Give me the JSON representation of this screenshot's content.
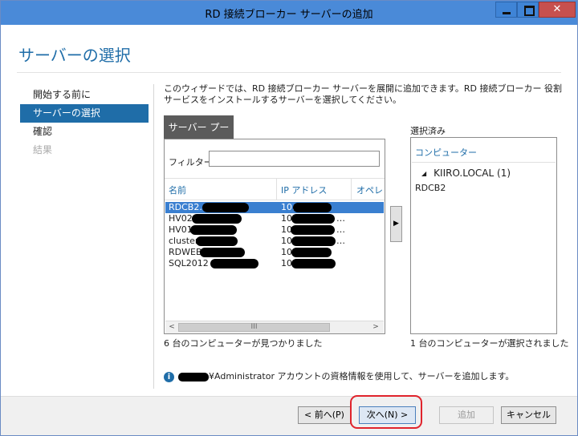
{
  "window": {
    "title": "RD 接続ブローカー サーバーの追加",
    "controls": {
      "minimize_icon": "minimize-icon",
      "maximize_icon": "maximize-icon",
      "close_label": "✕"
    }
  },
  "page": {
    "heading": "サーバーの選択"
  },
  "nav": {
    "items": [
      {
        "label": "開始する前に",
        "state": "normal"
      },
      {
        "label": "サーバーの選択",
        "state": "active"
      },
      {
        "label": "確認",
        "state": "normal"
      },
      {
        "label": "結果",
        "state": "disabled"
      }
    ]
  },
  "description": "このウィザードでは、RD 接続ブローカー サーバーを展開に追加できます。RD 接続ブローカー 役割サービスをインストールするサーバーを選択してください。",
  "server_pool": {
    "tab_label": "サーバー プール",
    "filter_label": "フィルター:",
    "filter_value": "",
    "columns": [
      "名前",
      "IP アドレス",
      "オペレー"
    ],
    "rows": [
      {
        "name": "RDCB2.",
        "ip": "10.",
        "ip_suffix": "",
        "selected": true
      },
      {
        "name": "HV02",
        "ip": "10",
        "ip_suffix": "…",
        "selected": false
      },
      {
        "name": "HV01",
        "ip": "10",
        "ip_suffix": "…",
        "selected": false
      },
      {
        "name": "cluster",
        "ip": "10",
        "ip_suffix": "…",
        "selected": false
      },
      {
        "name": "RDWEB",
        "ip": "10",
        "ip_suffix": "",
        "selected": false
      },
      {
        "name": "SQL2012",
        "ip": "10",
        "ip_suffix": "",
        "selected": false
      }
    ],
    "scroll_left": "<",
    "scroll_thumb": "III",
    "scroll_right": ">",
    "found_text": "6 台のコンピューターが見つかりました"
  },
  "add_arrow": "▶",
  "selected_panel": {
    "label": "選択済み",
    "column": "コンピューター",
    "group": "KIIRO.LOCAL (1)",
    "items": [
      "RDCB2"
    ],
    "count_text": "1 台のコンピューターが選択されました"
  },
  "info": {
    "text": "¥Administrator アカウントの資格情報を使用して、サーバーを追加します。"
  },
  "buttons": {
    "prev": "< 前へ(P)",
    "next": "次へ(N) >",
    "add": "追加",
    "cancel": "キャンセル"
  },
  "colors": {
    "accent": "#1f6da8",
    "titlebar": "#4a8ad8",
    "selection": "#3a7fd0",
    "highlight": "#e0242c"
  }
}
